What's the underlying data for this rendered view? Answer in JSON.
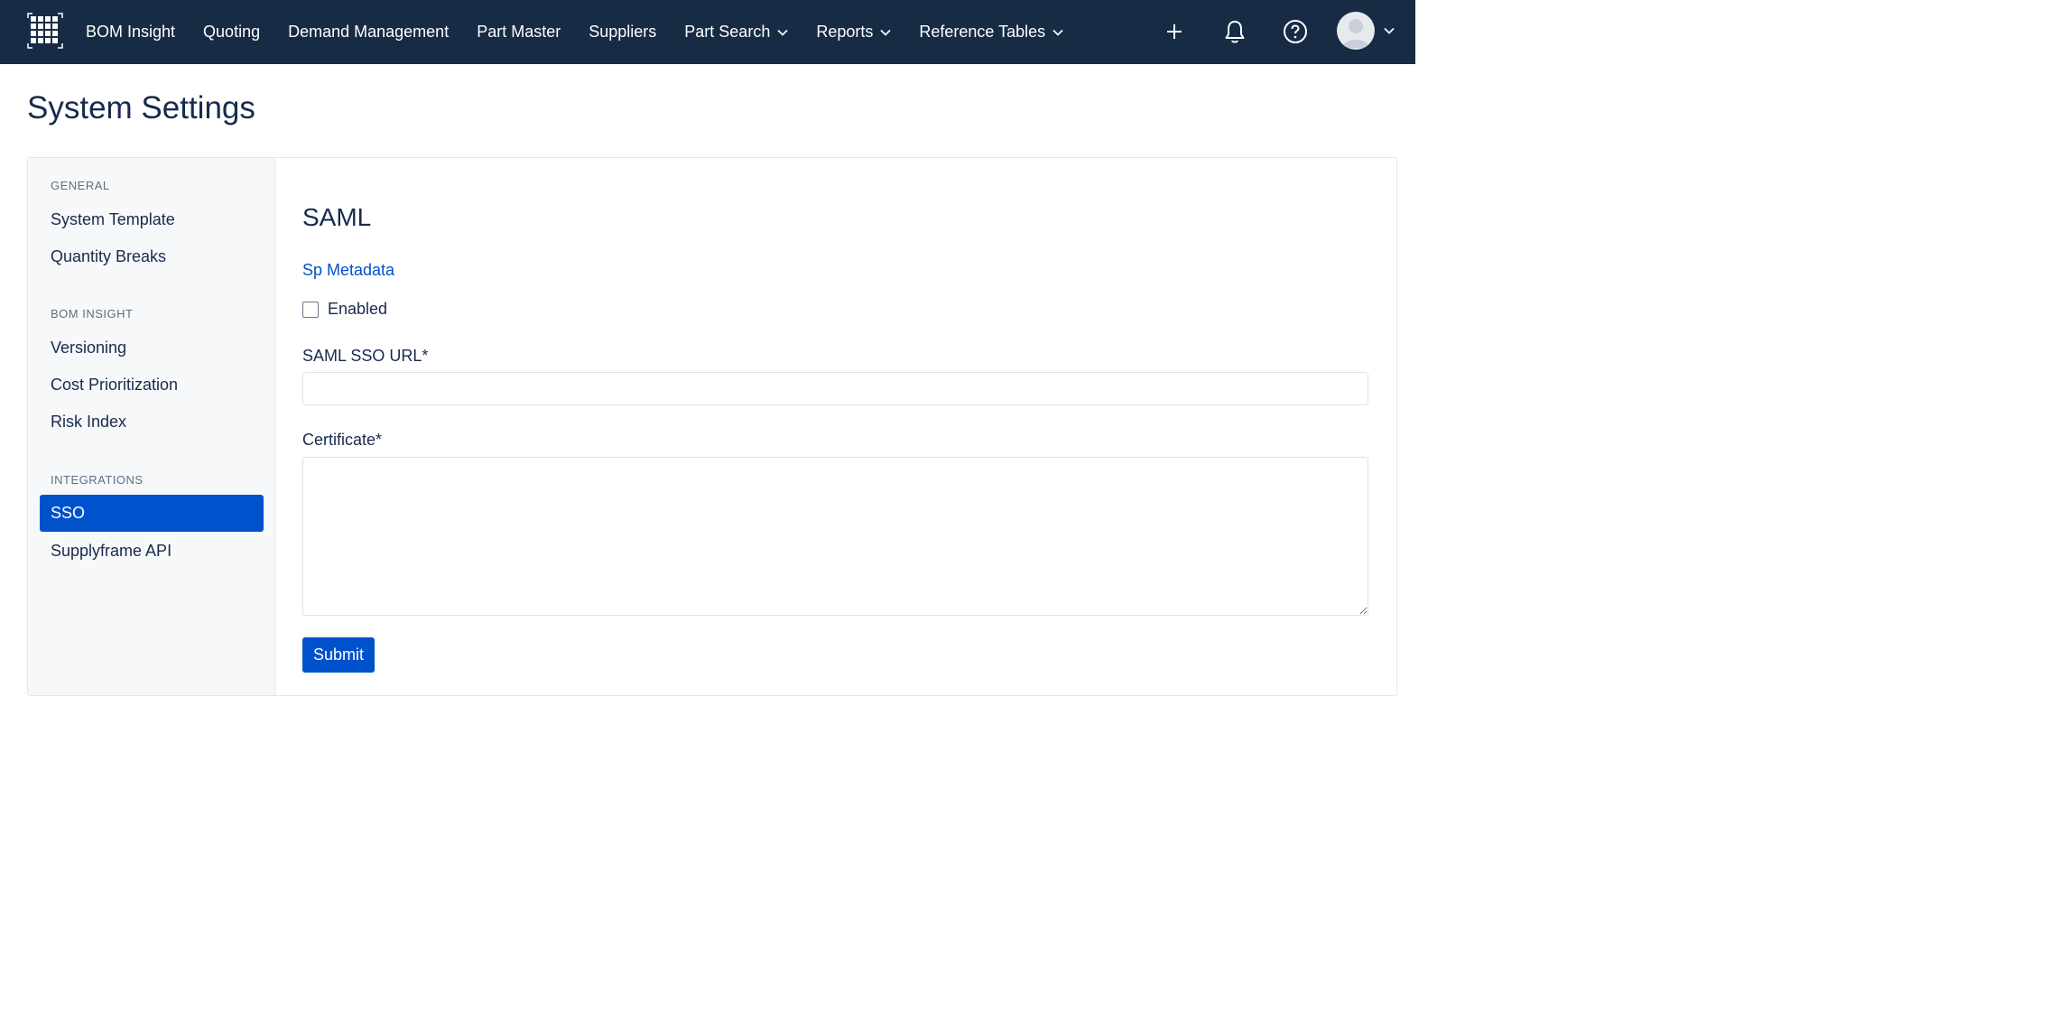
{
  "header": {
    "logo_icon": "grid-logo-icon",
    "nav": [
      {
        "label": "BOM Insight",
        "has_dropdown": false
      },
      {
        "label": "Quoting",
        "has_dropdown": false
      },
      {
        "label": "Demand Management",
        "has_dropdown": false
      },
      {
        "label": "Part Master",
        "has_dropdown": false
      },
      {
        "label": "Suppliers",
        "has_dropdown": false
      },
      {
        "label": "Part Search",
        "has_dropdown": true
      },
      {
        "label": "Reports",
        "has_dropdown": true
      },
      {
        "label": "Reference Tables",
        "has_dropdown": true
      }
    ],
    "actions": [
      "plus-icon",
      "bell-icon",
      "help-icon",
      "avatar"
    ],
    "colors": {
      "bar": "#172b45",
      "text": "#ffffff"
    }
  },
  "page": {
    "title": "System Settings"
  },
  "sidebar": {
    "sections": [
      {
        "label": "GENERAL",
        "items": [
          "System Template",
          "Quantity Breaks"
        ]
      },
      {
        "label": "BOM INSIGHT",
        "items": [
          "Versioning",
          "Cost Prioritization",
          "Risk Index"
        ]
      },
      {
        "label": "INTEGRATIONS",
        "items": [
          "SSO",
          "Supplyframe API"
        ]
      }
    ],
    "active_item": "SSO"
  },
  "main": {
    "section_title": "SAML",
    "metadata_link": "Sp Metadata",
    "enabled_label": "Enabled",
    "enabled_checked": false,
    "sso_url_label": "SAML SSO URL*",
    "sso_url_value": "",
    "certificate_label": "Certificate*",
    "certificate_value": "",
    "submit_label": "Submit"
  },
  "colors": {
    "accent": "#0052cc",
    "sidebar_bg": "#f7f8f9",
    "heading": "#172b4d"
  }
}
